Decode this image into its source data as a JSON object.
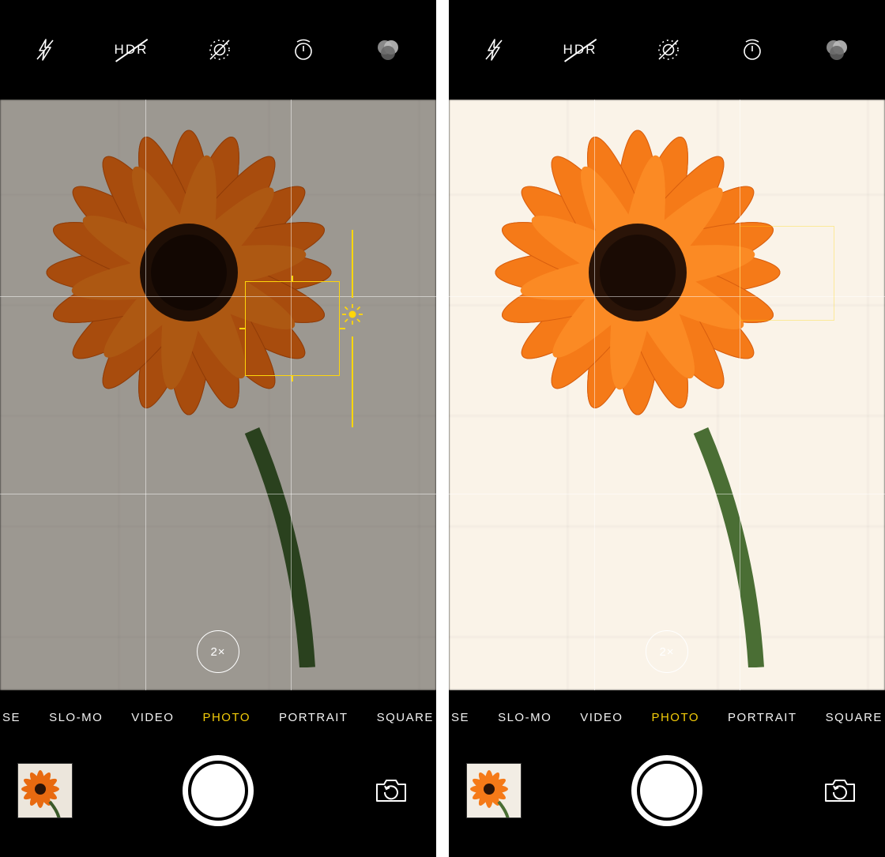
{
  "top_icons": {
    "flash": "flash-off-icon",
    "hdr_label": "HDR",
    "live": "live-photo-off-icon",
    "timer": "timer-icon",
    "filters": "filters-icon"
  },
  "zoom_label": "2×",
  "modes": [
    "SE",
    "SLO-MO",
    "VIDEO",
    "PHOTO",
    "PORTRAIT",
    "SQUARE"
  ],
  "selected_mode_index": 3,
  "focus": {
    "visible_left": true,
    "visible_right": false
  },
  "exposure_indicator": "sun-icon",
  "colors": {
    "accent": "#ffd60a"
  }
}
